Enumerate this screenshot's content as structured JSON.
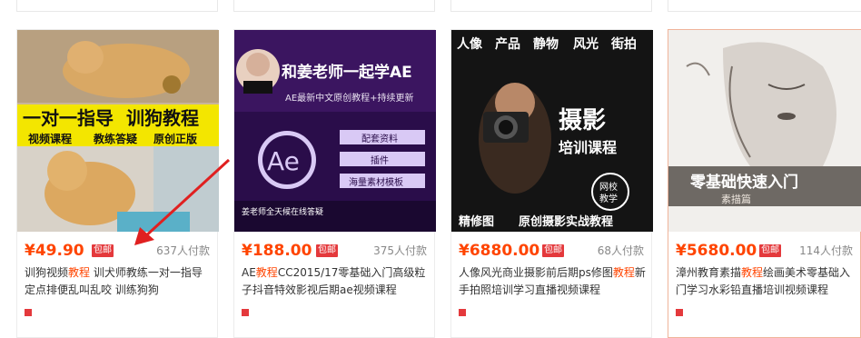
{
  "products": [
    {
      "image_lines": [
        "一对一指导",
        "训狗教程",
        "视频课程",
        "教练答疑",
        "原创正版"
      ],
      "price": "¥49.90",
      "badge": "包邮",
      "sold": "637人付款",
      "title_pre": "训狗视频",
      "title_hl": "教程",
      "title_post": " 训犬师教练一对一指导定点排便乱叫乱咬 训练狗狗",
      "shop": "",
      "location": ""
    },
    {
      "image_lines": [
        "和姜老师一起学AE",
        "AE最新中文原创教程+持续更新",
        "Ae",
        "配套资料",
        "插件",
        "海量素材模板",
        "姜老师全天候在线答疑"
      ],
      "price": "¥188.00",
      "badge": "包邮",
      "sold": "375人付款",
      "title_pre": "AE",
      "title_hl": "教程",
      "title_post": "CC2015/17零基础入门高级粒子抖音特效影视后期ae视频课程",
      "shop": "",
      "location": ""
    },
    {
      "image_lines": [
        "人像",
        "产品",
        "静物",
        "风光",
        "街拍",
        "摄影",
        "培训课程",
        "网校",
        "教学",
        "精修图",
        "原创摄影实战教程"
      ],
      "price": "¥6880.00",
      "badge": "包邮",
      "sold": "68人付款",
      "title_pre": "人像风光商业摄影前后期ps修图",
      "title_hl": "教程",
      "title_post": "新手拍照培训学习直播视频课程",
      "shop": "",
      "location": ""
    },
    {
      "image_lines": [
        "零基础快速入门",
        "素描篇"
      ],
      "price": "¥5680.00",
      "badge": "包邮",
      "sold": "114人付款",
      "title_pre": "漳州教育素描",
      "title_hl": "教程",
      "title_post": "绘画美术零基础入门学习水彩铅直播培训视频课程",
      "shop": "",
      "location": ""
    }
  ],
  "colors": {
    "price": "#ff4400",
    "badge": "#e4393c",
    "highlight": "#ff4400"
  }
}
